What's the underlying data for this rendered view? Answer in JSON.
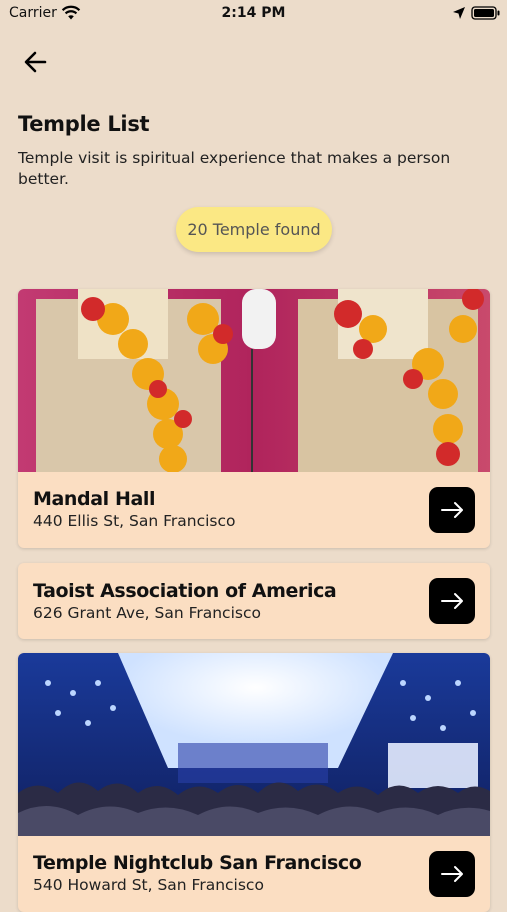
{
  "status_bar": {
    "carrier": "Carrier",
    "time": "2:14 PM"
  },
  "header": {
    "back_icon": "arrow-left-icon",
    "title": "Temple List",
    "subtitle": "Temple visit is spiritual experience that makes a person better."
  },
  "found_badge": "20 Temple found",
  "temples": [
    {
      "name": "Mandal Hall",
      "address": "440 Ellis St, San Francisco",
      "has_image": true,
      "image": "deity statues with flower garlands"
    },
    {
      "name": "Taoist Association of America",
      "address": "626 Grant Ave, San Francisco",
      "has_image": false
    },
    {
      "name": "Temple Nightclub San Francisco",
      "address": "540 Howard St, San Francisco",
      "has_image": true,
      "image": "nightclub crowd under blue lights"
    }
  ],
  "colors": {
    "background": "#ecdcca",
    "card": "#fbdec2",
    "badge": "#fbe884",
    "button": "#000000"
  }
}
